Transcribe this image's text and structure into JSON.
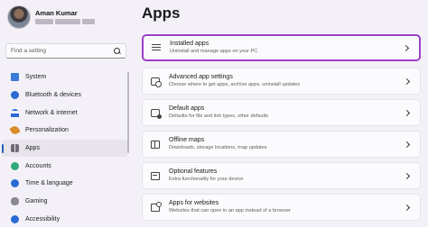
{
  "user": {
    "name": "Aman Kumar"
  },
  "search": {
    "placeholder": "Find a setting"
  },
  "sidebar": {
    "items": [
      {
        "label": "System",
        "icon": "system-icon"
      },
      {
        "label": "Bluetooth & devices",
        "icon": "bluetooth-icon"
      },
      {
        "label": "Network & internet",
        "icon": "network-icon"
      },
      {
        "label": "Personalization",
        "icon": "personalization-icon"
      },
      {
        "label": "Apps",
        "icon": "apps-icon",
        "active": true
      },
      {
        "label": "Accounts",
        "icon": "accounts-icon"
      },
      {
        "label": "Time & language",
        "icon": "time-language-icon"
      },
      {
        "label": "Gaming",
        "icon": "gaming-icon"
      },
      {
        "label": "Accessibility",
        "icon": "accessibility-icon"
      }
    ]
  },
  "main": {
    "title": "Apps",
    "cards": [
      {
        "title": "Installed apps",
        "subtitle": "Uninstall and manage apps on your PC",
        "icon": "installed-apps-icon",
        "highlighted": true
      },
      {
        "title": "Advanced app settings",
        "subtitle": "Choose where to get apps, archive apps, uninstall updates",
        "icon": "advanced-app-settings-icon"
      },
      {
        "title": "Default apps",
        "subtitle": "Defaults for file and link types, other defaults",
        "icon": "default-apps-icon"
      },
      {
        "title": "Offline maps",
        "subtitle": "Downloads, storage locations, map updates",
        "icon": "offline-maps-icon"
      },
      {
        "title": "Optional features",
        "subtitle": "Extra functionality for your device",
        "icon": "optional-features-icon"
      },
      {
        "title": "Apps for websites",
        "subtitle": "Websites that can open in an app instead of a browser",
        "icon": "apps-for-websites-icon"
      }
    ]
  },
  "colors": {
    "accent": "#2b5fb9",
    "highlight_border": "#9b3fc7",
    "background": "#f3f1f7"
  }
}
